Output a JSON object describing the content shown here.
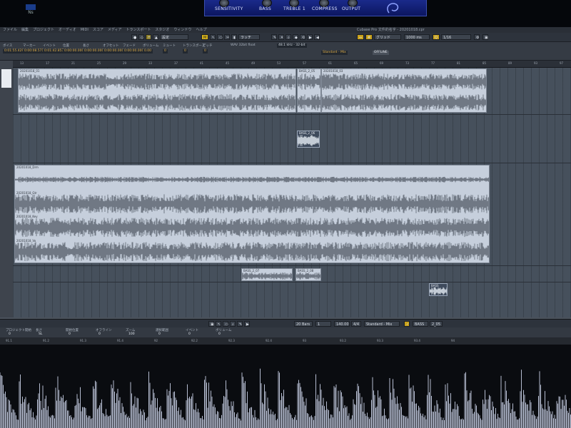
{
  "plugin": {
    "knobs": [
      "SENSITIVITY",
      "BASS",
      "TREBLE 1",
      "COMPRESS",
      "OUTPUT"
    ]
  },
  "bezel": {
    "brand": "Ns"
  },
  "window_title": "Cubase Pro 文件的名字 - 20201018.cpr",
  "menubar": [
    "ファイル",
    "編集",
    "プロジェクト",
    "オーディオ",
    "MIDI",
    "スコア",
    "メディア",
    "トランスポート",
    "スタジオ",
    "ウィンドウ",
    "ヘルプ"
  ],
  "toolbar": {
    "mode": "設定",
    "snap_type": "ラッチ",
    "grid_type": "グリッド",
    "quantize": "1/16",
    "tempo_label": "1000 ms"
  },
  "infobar": {
    "fields": [
      {
        "label": "ボイス",
        "value": "0:01:55.429"
      },
      {
        "label": "マーカー",
        "value": "0:00:08.571"
      },
      {
        "label": "イベント",
        "value": "0:01:42.857"
      },
      {
        "label": "位置",
        "value": "0:00:00.000"
      },
      {
        "label": "長さ",
        "value": "0:00:00.000"
      },
      {
        "label": "オフセット",
        "value": "0:00:00.000"
      },
      {
        "label": "フェード",
        "value": "0:00:00.000"
      },
      {
        "label": "ボリューム",
        "value": "0.00"
      },
      {
        "label": "ミュート",
        "value": "0"
      },
      {
        "label": "トランスポーズ",
        "value": "0"
      },
      {
        "label": "ピッチ",
        "value": "0"
      }
    ],
    "format": "WAV 32bit float",
    "sample_rate": "48.1 kHz - 32-bit",
    "preset": "Standard - Mix",
    "mode_btn": "OFFLINE"
  },
  "ruler_ticks": [
    "13",
    "17",
    "21",
    "25",
    "29",
    "33",
    "37",
    "41",
    "45",
    "49",
    "53",
    "57",
    "61",
    "65",
    "69",
    "73",
    "77",
    "81",
    "85",
    "89",
    "93",
    "97"
  ],
  "clips": [
    {
      "name": "20201018_01"
    },
    {
      "name": "BASS_2_05"
    },
    {
      "name": "20201018_03"
    },
    {
      "name": "BASS_2_06"
    },
    {
      "name": "20201018_Drm"
    },
    {
      "name": "20201018_Gtr"
    },
    {
      "name": "20201018_Key"
    },
    {
      "name": "20201018_Vo"
    },
    {
      "name": "BASS_2_07"
    },
    {
      "name": "BASS_2_08"
    },
    {
      "name": "BASS"
    }
  ],
  "lowbar": {
    "bars": "20 Bars",
    "beats": "1 Beats",
    "tempo": "140.00",
    "signature": "4/4",
    "preset": "Standard - Mix",
    "track": "BASS",
    "clip": "2_05"
  },
  "propbar": [
    {
      "label": "プロジェクト開始",
      "value": "0"
    },
    {
      "label": "長さ",
      "value": "SL"
    },
    {
      "label": "開始位置",
      "value": "0"
    },
    {
      "label": "オフライン",
      "value": "0"
    },
    {
      "label": "ズーム",
      "value": "100"
    },
    {
      "label": "選択範囲",
      "value": "0"
    },
    {
      "label": "イベント",
      "value": "0"
    },
    {
      "label": "ボリューム",
      "value": "0"
    }
  ],
  "editor_ruler": [
    "91.1",
    "91.2",
    "91.3",
    "91.4",
    "92",
    "92.2",
    "92.3",
    "92.4",
    "93",
    "93.2",
    "93.3",
    "93.4",
    "94"
  ],
  "colors": {
    "accent": "#e2b04a",
    "clip": "#c6cfdc",
    "lane": "#46505c",
    "bass_clip": "#3e4a5c"
  }
}
